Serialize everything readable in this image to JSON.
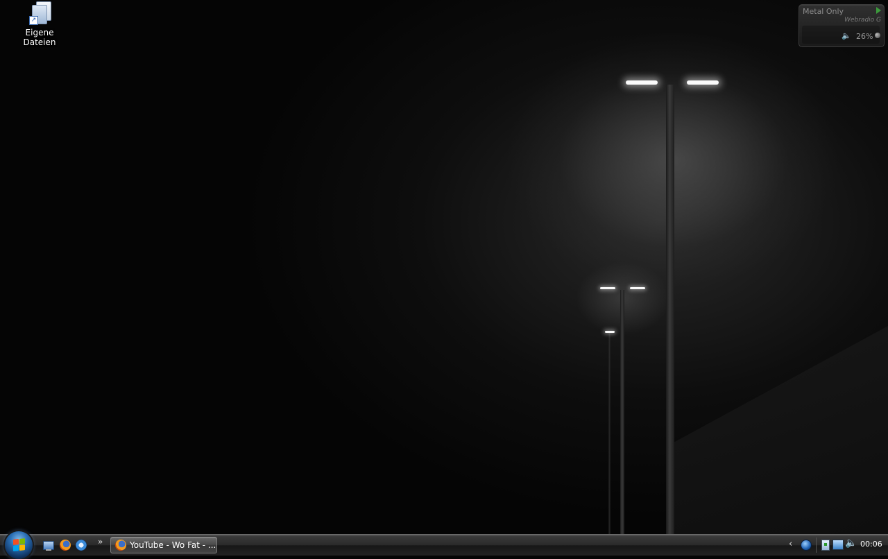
{
  "desktop": {
    "icons": [
      {
        "label": "Eigene Dateien",
        "icon": "my-documents-icon"
      }
    ]
  },
  "gadget": {
    "station": "Metal Only",
    "subtitle": "Webradio G",
    "volume": "26%",
    "play_icon": "play-icon",
    "volume_icon": "speaker-icon"
  },
  "taskbar": {
    "start_icon": "windows-start-orb",
    "quick_launch": [
      {
        "name": "show-desktop",
        "icon": "show-desktop-icon"
      },
      {
        "name": "firefox",
        "icon": "firefox-icon"
      },
      {
        "name": "internet-explorer",
        "icon": "internet-explorer-icon"
      }
    ],
    "quick_launch_more": "»",
    "tasks": [
      {
        "label": "YouTube - Wo Fat - ...",
        "icon": "firefox-icon",
        "active": true
      }
    ],
    "tray": {
      "chevron": "‹",
      "icons": [
        "globe-icon",
        "safely-remove-icon",
        "network-icon",
        "volume-icon"
      ],
      "volume_glyph": "🔈",
      "clock": "00:06"
    }
  },
  "colors": {
    "taskbar": "#2a2a2a",
    "start_orb": "#2a6fb5",
    "wallpaper": "#050505"
  }
}
